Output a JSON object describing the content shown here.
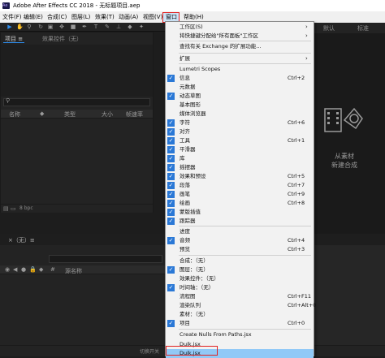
{
  "app": {
    "title": "Adobe After Effects CC 2018 - 无标题项目.aep"
  },
  "menubar": {
    "items": [
      "文件(F)",
      "编辑(E)",
      "合成(C)",
      "图层(L)",
      "效果(T)",
      "动画(A)",
      "视图(V)",
      "窗口",
      "帮助(H)"
    ]
  },
  "project_panel": {
    "tab_project": "项目 ≡",
    "tab_effects": "效果控件（无）",
    "search_placeholder": "",
    "columns": [
      "名称",
      "类型",
      "大小",
      "帧速率"
    ],
    "bpc": "8 bpc"
  },
  "timeline": {
    "tab": "×（无）≡",
    "source_name": "源名称",
    "bottom_label": "切换开关"
  },
  "workspace": {
    "default": "默认",
    "standard": "标准"
  },
  "composition": {
    "from_footage": "从素材",
    "new_comp": "新建合成"
  },
  "window_menu": {
    "items": [
      {
        "label": "工作区(S)",
        "shortcut": "",
        "checked": false,
        "submenu": true
      },
      {
        "label": "将快捷键分配给\"所有面板\"工作区",
        "shortcut": "",
        "checked": false,
        "submenu": true
      },
      {
        "label": "查找有关 Exchange 的扩展功能...",
        "shortcut": "",
        "checked": false,
        "submenu": false
      },
      {
        "label": "扩展",
        "shortcut": "",
        "checked": false,
        "submenu": true
      },
      {
        "label": "Lumetri Scopes",
        "shortcut": "",
        "checked": false,
        "submenu": false
      },
      {
        "label": "信息",
        "shortcut": "Ctrl+2",
        "checked": true,
        "submenu": false
      },
      {
        "label": "元数据",
        "shortcut": "",
        "checked": false,
        "submenu": false
      },
      {
        "label": "动态草图",
        "shortcut": "",
        "checked": true,
        "submenu": false
      },
      {
        "label": "基本图形",
        "shortcut": "",
        "checked": false,
        "submenu": false
      },
      {
        "label": "媒体浏览器",
        "shortcut": "",
        "checked": false,
        "submenu": false
      },
      {
        "label": "字符",
        "shortcut": "Ctrl+6",
        "checked": true,
        "submenu": false
      },
      {
        "label": "对齐",
        "shortcut": "",
        "checked": true,
        "submenu": false
      },
      {
        "label": "工具",
        "shortcut": "Ctrl+1",
        "checked": true,
        "submenu": false
      },
      {
        "label": "平滑器",
        "shortcut": "",
        "checked": true,
        "submenu": false
      },
      {
        "label": "库",
        "shortcut": "",
        "checked": true,
        "submenu": false
      },
      {
        "label": "摇摆器",
        "shortcut": "",
        "checked": true,
        "submenu": false
      },
      {
        "label": "效果和预设",
        "shortcut": "Ctrl+5",
        "checked": true,
        "submenu": false
      },
      {
        "label": "段落",
        "shortcut": "Ctrl+7",
        "checked": true,
        "submenu": false
      },
      {
        "label": "画笔",
        "shortcut": "Ctrl+9",
        "checked": true,
        "submenu": false
      },
      {
        "label": "绘画",
        "shortcut": "Ctrl+8",
        "checked": true,
        "submenu": false
      },
      {
        "label": "蒙版插值",
        "shortcut": "",
        "checked": true,
        "submenu": false
      },
      {
        "label": "跟踪器",
        "shortcut": "",
        "checked": true,
        "submenu": false
      },
      {
        "label": "进度",
        "shortcut": "",
        "checked": false,
        "submenu": false
      },
      {
        "label": "音频",
        "shortcut": "Ctrl+4",
        "checked": true,
        "submenu": false
      },
      {
        "label": "预览",
        "shortcut": "Ctrl+3",
        "checked": false,
        "submenu": false
      },
      {
        "label": "合成：（无）",
        "shortcut": "",
        "checked": false,
        "submenu": false
      },
      {
        "label": "图层：（无）",
        "shortcut": "",
        "checked": true,
        "submenu": false
      },
      {
        "label": "效果控件：（无）",
        "shortcut": "",
        "checked": false,
        "submenu": false
      },
      {
        "label": "时间轴：（无）",
        "shortcut": "",
        "checked": true,
        "submenu": false
      },
      {
        "label": "流程图",
        "shortcut": "Ctrl+F11",
        "checked": false,
        "submenu": false
      },
      {
        "label": "渲染队列",
        "shortcut": "Ctrl+Alt+0",
        "checked": false,
        "submenu": false
      },
      {
        "label": "素材：（无）",
        "shortcut": "",
        "checked": false,
        "submenu": false
      },
      {
        "label": "项目",
        "shortcut": "Ctrl+0",
        "checked": true,
        "submenu": false
      },
      {
        "label": "Create Nulls From Paths.jsx",
        "shortcut": "",
        "checked": false,
        "submenu": false
      },
      {
        "label": "Duik.jsx",
        "shortcut": "",
        "checked": false,
        "submenu": false
      },
      {
        "label": "Duik.jsx",
        "shortcut": "",
        "checked": false,
        "submenu": false,
        "highlighted": true
      }
    ]
  },
  "colors": {
    "accent": "#2a78d6",
    "highlight_box": "#e02020",
    "menu_bg": "#f2f2f2",
    "panel_bg": "#232323"
  }
}
